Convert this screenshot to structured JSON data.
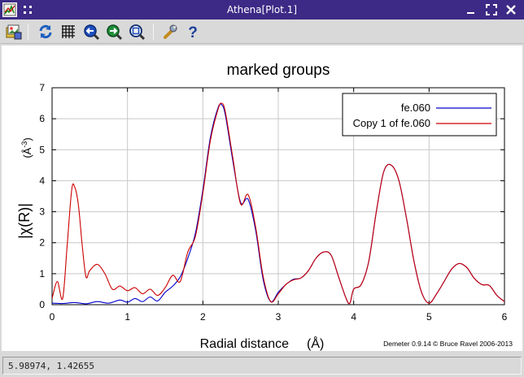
{
  "window": {
    "title": "Athena[Plot.1]"
  },
  "toolbar": {
    "tools": [
      {
        "name": "save-image-button",
        "icon": "image-save-icon"
      },
      {
        "name": "replot-button",
        "icon": "refresh-icon"
      },
      {
        "name": "grid-toggle-button",
        "icon": "grid-icon"
      },
      {
        "name": "zoom-in-button",
        "icon": "magnifier-zoom-in-icon"
      },
      {
        "name": "zoom-out-button",
        "icon": "magnifier-zoom-out-icon"
      },
      {
        "name": "zoom-reset-button",
        "icon": "magnifier-reset-icon"
      },
      {
        "name": "terminal-button",
        "icon": "wrench-icon"
      },
      {
        "name": "help-button",
        "icon": "help-icon"
      }
    ]
  },
  "chart_data": {
    "type": "line",
    "title": "marked groups",
    "xlabel": "Radial distance",
    "xlabel_unit": "(Å)",
    "ylabel": "|χ(R)|",
    "ylabel_unit_base": "(Å",
    "ylabel_unit_exp": "-3",
    "ylabel_unit_close": ")",
    "xlim": [
      0,
      6
    ],
    "ylim": [
      0,
      7
    ],
    "xticks": [
      "0",
      "1",
      "2",
      "3",
      "4",
      "5",
      "6"
    ],
    "yticks": [
      "0",
      "1",
      "2",
      "3",
      "4",
      "5",
      "6",
      "7"
    ],
    "grid": true,
    "legend_position": "top-right",
    "credit": "Demeter 0.9.14 © Bruce Ravel 2006-2013",
    "series": [
      {
        "name": "fe.060",
        "color": "#0000cc",
        "x": [
          0.0,
          0.15,
          0.3,
          0.45,
          0.6,
          0.75,
          0.9,
          1.0,
          1.1,
          1.2,
          1.3,
          1.4,
          1.5,
          1.6,
          1.7,
          1.8,
          1.9,
          2.0,
          2.1,
          2.2,
          2.25,
          2.3,
          2.4,
          2.5,
          2.6,
          2.7,
          2.8,
          2.9,
          3.0,
          3.1,
          3.2,
          3.3,
          3.4,
          3.5,
          3.6,
          3.7,
          3.8,
          3.9,
          3.95,
          4.0,
          4.1,
          4.2,
          4.3,
          4.4,
          4.5,
          4.6,
          4.7,
          4.8,
          4.9,
          5.0,
          5.1,
          5.2,
          5.3,
          5.4,
          5.5,
          5.6,
          5.7,
          5.8,
          5.9,
          6.0
        ],
        "y": [
          0.05,
          0.04,
          0.07,
          0.03,
          0.1,
          0.05,
          0.15,
          0.08,
          0.2,
          0.1,
          0.25,
          0.12,
          0.4,
          0.6,
          0.9,
          1.5,
          2.3,
          3.7,
          5.4,
          6.35,
          6.45,
          6.1,
          4.6,
          3.3,
          3.4,
          2.4,
          0.8,
          0.1,
          0.4,
          0.65,
          0.82,
          0.86,
          1.1,
          1.5,
          1.7,
          1.6,
          0.9,
          0.2,
          0.05,
          0.5,
          0.65,
          1.4,
          3.0,
          4.3,
          4.5,
          4.0,
          2.8,
          1.4,
          0.4,
          0.05,
          0.35,
          0.75,
          1.15,
          1.33,
          1.2,
          0.85,
          0.65,
          0.62,
          0.3,
          0.1
        ]
      },
      {
        "name": "Copy 1 of fe.060",
        "color": "#cc0000",
        "x": [
          0.0,
          0.07,
          0.14,
          0.2,
          0.26,
          0.3,
          0.35,
          0.4,
          0.45,
          0.5,
          0.6,
          0.7,
          0.8,
          0.9,
          1.0,
          1.1,
          1.2,
          1.3,
          1.4,
          1.5,
          1.6,
          1.7,
          1.8,
          1.9,
          2.0,
          2.1,
          2.2,
          2.25,
          2.3,
          2.4,
          2.5,
          2.6,
          2.7,
          2.8,
          2.9,
          3.0,
          3.1,
          3.2,
          3.3,
          3.4,
          3.5,
          3.6,
          3.7,
          3.8,
          3.9,
          3.95,
          4.0,
          4.1,
          4.2,
          4.3,
          4.4,
          4.5,
          4.6,
          4.7,
          4.8,
          4.9,
          5.0,
          5.1,
          5.2,
          5.3,
          5.4,
          5.5,
          5.6,
          5.7,
          5.8,
          5.9,
          6.0
        ],
        "y": [
          0.2,
          0.75,
          0.2,
          1.9,
          3.7,
          3.8,
          3.2,
          1.9,
          0.9,
          1.1,
          1.3,
          1.0,
          0.5,
          0.6,
          0.45,
          0.55,
          0.35,
          0.5,
          0.3,
          0.55,
          0.95,
          0.75,
          1.7,
          2.2,
          3.6,
          5.3,
          6.3,
          6.5,
          6.2,
          4.7,
          3.25,
          3.55,
          2.5,
          0.9,
          0.1,
          0.35,
          0.65,
          0.8,
          0.86,
          1.1,
          1.5,
          1.7,
          1.6,
          0.9,
          0.2,
          0.05,
          0.5,
          0.65,
          1.4,
          3.0,
          4.3,
          4.5,
          4.0,
          2.8,
          1.4,
          0.4,
          0.05,
          0.35,
          0.75,
          1.15,
          1.33,
          1.2,
          0.85,
          0.65,
          0.62,
          0.3,
          0.1
        ]
      }
    ]
  },
  "status": {
    "coordinates": "5.98974, 1.42655"
  }
}
